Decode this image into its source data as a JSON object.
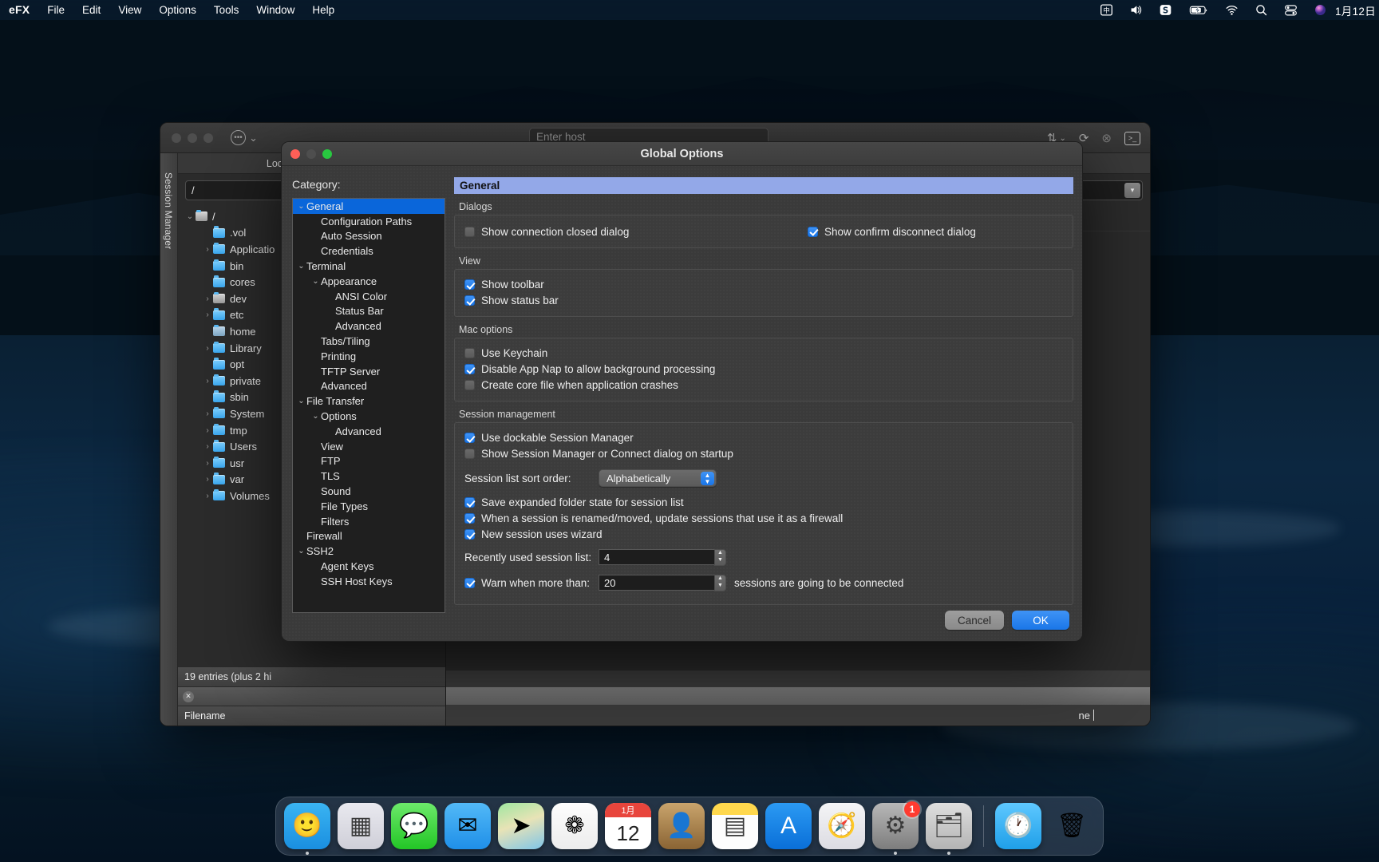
{
  "menubar": {
    "app_name": "eFX",
    "items": [
      "File",
      "Edit",
      "View",
      "Options",
      "Tools",
      "Window",
      "Help"
    ],
    "status_icons": [
      "input-source-icon",
      "volume-icon",
      "sogou-icon",
      "battery-icon",
      "wifi-icon",
      "search-icon",
      "control-center-icon",
      "siri-icon"
    ],
    "clock": "1月12日"
  },
  "app_window": {
    "host_placeholder": "Enter host",
    "session_manager_label": "Session Manager",
    "left_tab": "Local (MacBook-Pro",
    "path_value": "/",
    "root_label": "/",
    "tree": [
      {
        "name": ".vol",
        "arrow": false,
        "kind": "folder",
        "indent": 1
      },
      {
        "name": "Applicatio",
        "arrow": true,
        "kind": "folder",
        "indent": 1
      },
      {
        "name": "bin",
        "arrow": false,
        "kind": "folder",
        "indent": 1
      },
      {
        "name": "cores",
        "arrow": false,
        "kind": "folder",
        "indent": 1
      },
      {
        "name": "dev",
        "arrow": true,
        "kind": "disk",
        "indent": 1
      },
      {
        "name": "etc",
        "arrow": true,
        "kind": "folder",
        "indent": 1
      },
      {
        "name": "home",
        "arrow": false,
        "kind": "home",
        "indent": 1
      },
      {
        "name": "Library",
        "arrow": true,
        "kind": "folder",
        "indent": 1
      },
      {
        "name": "opt",
        "arrow": false,
        "kind": "folder",
        "indent": 1
      },
      {
        "name": "private",
        "arrow": true,
        "kind": "folder",
        "indent": 1
      },
      {
        "name": "sbin",
        "arrow": false,
        "kind": "folder",
        "indent": 1
      },
      {
        "name": "System",
        "arrow": true,
        "kind": "folder",
        "indent": 1
      },
      {
        "name": "tmp",
        "arrow": true,
        "kind": "folder",
        "indent": 1
      },
      {
        "name": "Users",
        "arrow": true,
        "kind": "folder",
        "indent": 1
      },
      {
        "name": "usr",
        "arrow": true,
        "kind": "folder",
        "indent": 1
      },
      {
        "name": "var",
        "arrow": true,
        "kind": "folder",
        "indent": 1
      },
      {
        "name": "Volumes",
        "arrow": true,
        "kind": "folder",
        "indent": 1
      }
    ],
    "entries_status": "19 entries (plus 2 hi",
    "filename_header": "Filename",
    "right_bottom_text": "ne",
    "toolbar_icons": [
      "sort-transfer-icon",
      "chevron-down-icon",
      "refresh-icon",
      "disconnect-icon",
      "terminal-icon"
    ]
  },
  "dialog": {
    "title": "Global Options",
    "category_label": "Category:",
    "categories": [
      {
        "label": "General",
        "indent": 0,
        "twisty": "v",
        "selected": true
      },
      {
        "label": "Configuration Paths",
        "indent": 1,
        "twisty": "",
        "selected": false
      },
      {
        "label": "Auto Session",
        "indent": 1,
        "twisty": "",
        "selected": false
      },
      {
        "label": "Credentials",
        "indent": 1,
        "twisty": "",
        "selected": false
      },
      {
        "label": "Terminal",
        "indent": 0,
        "twisty": "v",
        "selected": false
      },
      {
        "label": "Appearance",
        "indent": 1,
        "twisty": "v",
        "selected": false
      },
      {
        "label": "ANSI Color",
        "indent": 2,
        "twisty": "",
        "selected": false
      },
      {
        "label": "Status Bar",
        "indent": 2,
        "twisty": "",
        "selected": false
      },
      {
        "label": "Advanced",
        "indent": 2,
        "twisty": "",
        "selected": false
      },
      {
        "label": "Tabs/Tiling",
        "indent": 1,
        "twisty": "",
        "selected": false
      },
      {
        "label": "Printing",
        "indent": 1,
        "twisty": "",
        "selected": false
      },
      {
        "label": "TFTP Server",
        "indent": 1,
        "twisty": "",
        "selected": false
      },
      {
        "label": "Advanced",
        "indent": 1,
        "twisty": "",
        "selected": false
      },
      {
        "label": "File Transfer",
        "indent": 0,
        "twisty": "v",
        "selected": false
      },
      {
        "label": "Options",
        "indent": 1,
        "twisty": "v",
        "selected": false
      },
      {
        "label": "Advanced",
        "indent": 2,
        "twisty": "",
        "selected": false
      },
      {
        "label": "View",
        "indent": 1,
        "twisty": "",
        "selected": false
      },
      {
        "label": "FTP",
        "indent": 1,
        "twisty": "",
        "selected": false
      },
      {
        "label": "TLS",
        "indent": 1,
        "twisty": "",
        "selected": false
      },
      {
        "label": "Sound",
        "indent": 1,
        "twisty": "",
        "selected": false
      },
      {
        "label": "File Types",
        "indent": 1,
        "twisty": "",
        "selected": false
      },
      {
        "label": "Filters",
        "indent": 1,
        "twisty": "",
        "selected": false
      },
      {
        "label": "Firewall",
        "indent": 0,
        "twisty": "",
        "selected": false
      },
      {
        "label": "SSH2",
        "indent": 0,
        "twisty": "v",
        "selected": false
      },
      {
        "label": "Agent Keys",
        "indent": 1,
        "twisty": "",
        "selected": false
      },
      {
        "label": "SSH Host Keys",
        "indent": 1,
        "twisty": "",
        "selected": false
      }
    ],
    "pane_header": "General",
    "groups": {
      "dialogs": {
        "title": "Dialogs",
        "left_checkbox": {
          "label": "Show connection closed dialog",
          "checked": false
        },
        "right_checkbox": {
          "label": "Show confirm disconnect dialog",
          "checked": true
        }
      },
      "view": {
        "title": "View",
        "checkboxes": [
          {
            "label": "Show toolbar",
            "checked": true
          },
          {
            "label": "Show status bar",
            "checked": true
          }
        ]
      },
      "mac_options": {
        "title": "Mac options",
        "checkboxes": [
          {
            "label": "Use Keychain",
            "checked": false
          },
          {
            "label": "Disable App Nap to allow background processing",
            "checked": true
          },
          {
            "label": "Create core file when application crashes",
            "checked": false
          }
        ]
      },
      "session_management": {
        "title": "Session management",
        "checkboxes_top": [
          {
            "label": "Use dockable Session Manager",
            "checked": true
          },
          {
            "label": "Show Session Manager or Connect dialog on startup",
            "checked": false
          }
        ],
        "sort_order_label": "Session list sort order:",
        "sort_order_value": "Alphabetically",
        "checkboxes_mid": [
          {
            "label": "Save expanded folder state for session list",
            "checked": true
          },
          {
            "label": "When a session is renamed/moved, update sessions that use it as a firewall",
            "checked": true
          },
          {
            "label": "New session uses wizard",
            "checked": true
          }
        ],
        "recent_label": "Recently used session list:",
        "recent_value": "4",
        "warn_checkbox": {
          "label": "Warn when more than:",
          "checked": true
        },
        "warn_value": "20",
        "warn_suffix": "sessions are going to be connected"
      }
    },
    "buttons": {
      "cancel": "Cancel",
      "ok": "OK"
    }
  },
  "dock": {
    "items": [
      {
        "name": "finder",
        "glyph": "🙂"
      },
      {
        "name": "launchpad",
        "glyph": "▦"
      },
      {
        "name": "messages",
        "glyph": "💬"
      },
      {
        "name": "mail",
        "glyph": "✉"
      },
      {
        "name": "maps",
        "glyph": "➤"
      },
      {
        "name": "photos",
        "glyph": "❁"
      },
      {
        "name": "calendar",
        "glyph": "12",
        "sub": "1月"
      },
      {
        "name": "contacts",
        "glyph": "👤"
      },
      {
        "name": "notes",
        "glyph": "▤"
      },
      {
        "name": "app-store",
        "glyph": "A"
      },
      {
        "name": "safari",
        "glyph": "🧭"
      },
      {
        "name": "system-preferences",
        "glyph": "⚙",
        "badge": "1"
      },
      {
        "name": "screen-sharing",
        "glyph": "🗂"
      },
      {
        "name": "downloads-folder",
        "glyph": "🕐"
      },
      {
        "name": "trash",
        "glyph": "🗑"
      }
    ]
  }
}
